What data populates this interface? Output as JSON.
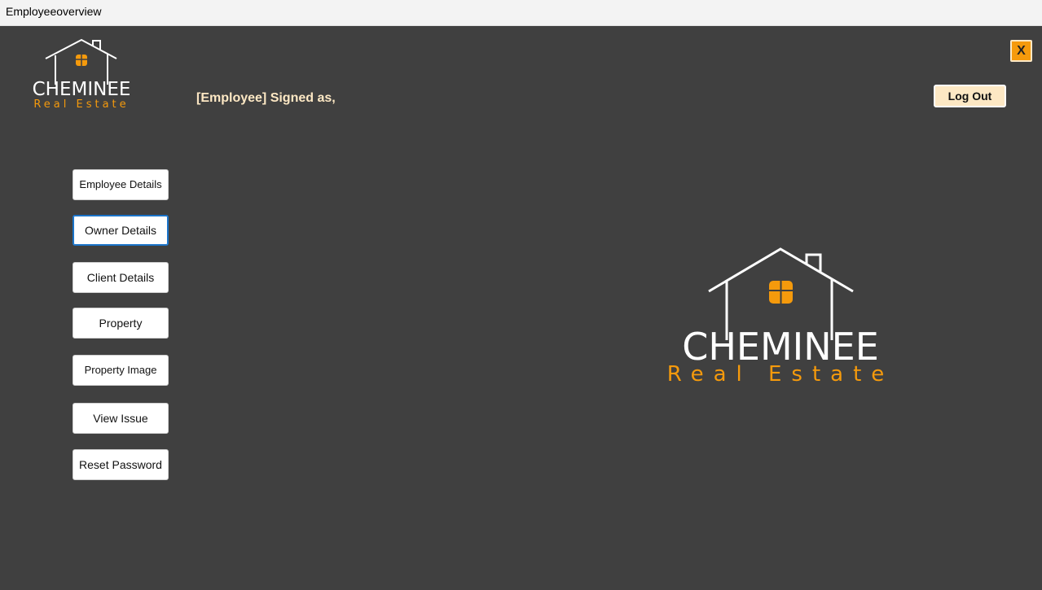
{
  "window": {
    "title": "Employeeoverview"
  },
  "header": {
    "signed_label": "[Employee] Signed as,",
    "logout_label": "Log Out",
    "close_label": "X"
  },
  "brand": {
    "name": "CHEMINEE",
    "tagline": "Real Estate"
  },
  "nav": {
    "employee_details": "Employee Details",
    "owner_details": "Owner Details",
    "client_details": "Client Details",
    "property": "Property",
    "property_image": "Property Image",
    "view_issue": "View Issue",
    "reset_password": "Reset Password"
  },
  "colors": {
    "background": "#404040",
    "accent": "#f59a0c",
    "cream": "#fde8c4",
    "white": "#ffffff"
  }
}
